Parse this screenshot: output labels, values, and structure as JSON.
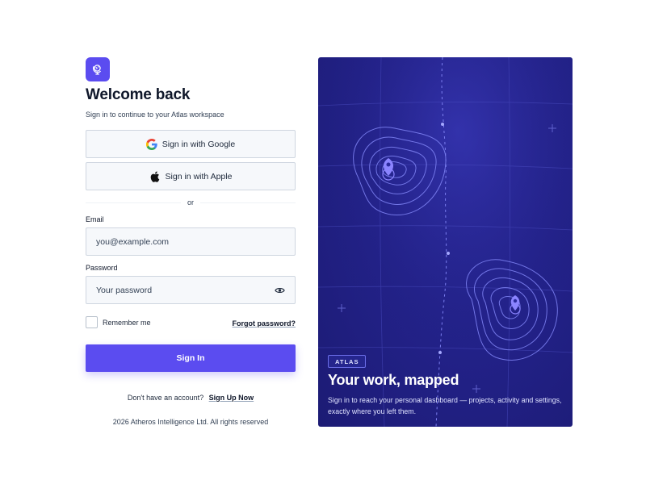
{
  "brand": {
    "icon": "globe-icon",
    "accent": "#5b4cf0"
  },
  "login": {
    "title": "Welcome back",
    "subtitle": "Sign in to continue to your Atlas workspace",
    "google_label": "Sign in with Google",
    "apple_label": "Sign in with Apple",
    "divider_text": "or",
    "email_label": "Email",
    "email_placeholder": "you@example.com",
    "email_value": "",
    "password_label": "Password",
    "password_placeholder": "Your password",
    "password_value": "",
    "remember_label": "Remember me",
    "remember_checked": false,
    "forgot_label": "Forgot password?",
    "submit_label": "Sign In",
    "signup_prompt": "Don't have an account?",
    "signup_link": "Sign Up Now",
    "footer": "2026 Atheros Intelligence Ltd. All rights reserved"
  },
  "panel": {
    "badge": "ATLAS",
    "title": "Your work, mapped",
    "text": "Sign in to reach your personal dashboard — projects, activity and settings, exactly where you left them.",
    "background": "#23228a",
    "pin_color": "#8b84ff"
  }
}
